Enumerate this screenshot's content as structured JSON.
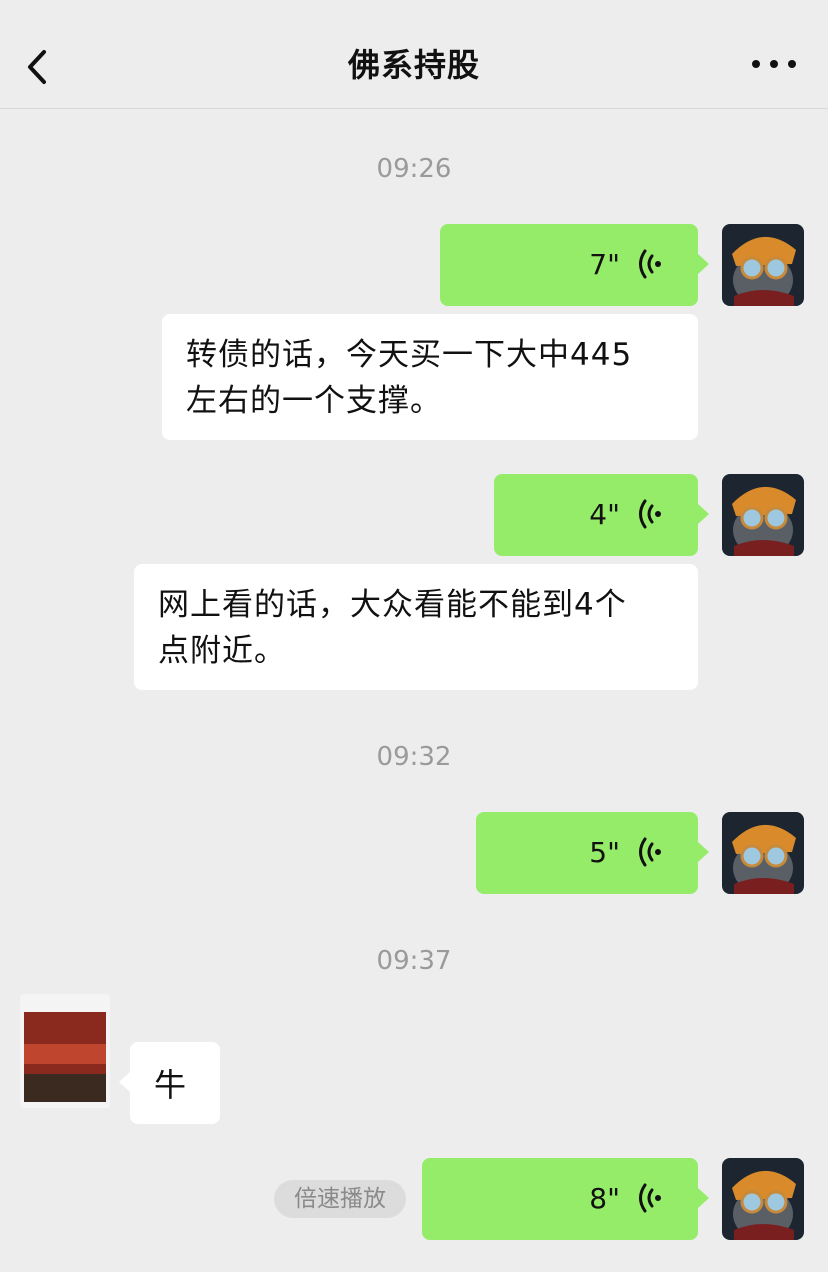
{
  "header": {
    "title": "佛系持股",
    "back_icon": "back-arrow-icon",
    "more_icon": "more-dots-icon"
  },
  "timestamps": [
    "09:26",
    "09:32",
    "09:37"
  ],
  "messages": [
    {
      "type": "voice",
      "sender": "me",
      "duration": "7\""
    },
    {
      "type": "transcript",
      "text": "转债的话，今天买一下大中445左右的一个支撑。"
    },
    {
      "type": "voice",
      "sender": "me",
      "duration": "4\""
    },
    {
      "type": "transcript",
      "text": "网上看的话，大众看能不能到4个点附近。"
    },
    {
      "type": "voice",
      "sender": "me",
      "duration": "5\""
    },
    {
      "type": "text",
      "sender": "other",
      "text": "牛"
    },
    {
      "type": "voice",
      "sender": "me",
      "duration": "8\""
    }
  ],
  "transcript_lines": {
    "t1_line1": "转债的话，今天买一下大中445",
    "t1_line2": "左右的一个支撑。",
    "t2_line1": "网上看的话，大众看能不能到4个",
    "t2_line2": "点附近。"
  },
  "speed_button": "倍速播放",
  "colors": {
    "background": "#ededed",
    "sent_bubble": "#95ec69",
    "received_bubble": "#ffffff",
    "timestamp": "#9a9a9a"
  }
}
